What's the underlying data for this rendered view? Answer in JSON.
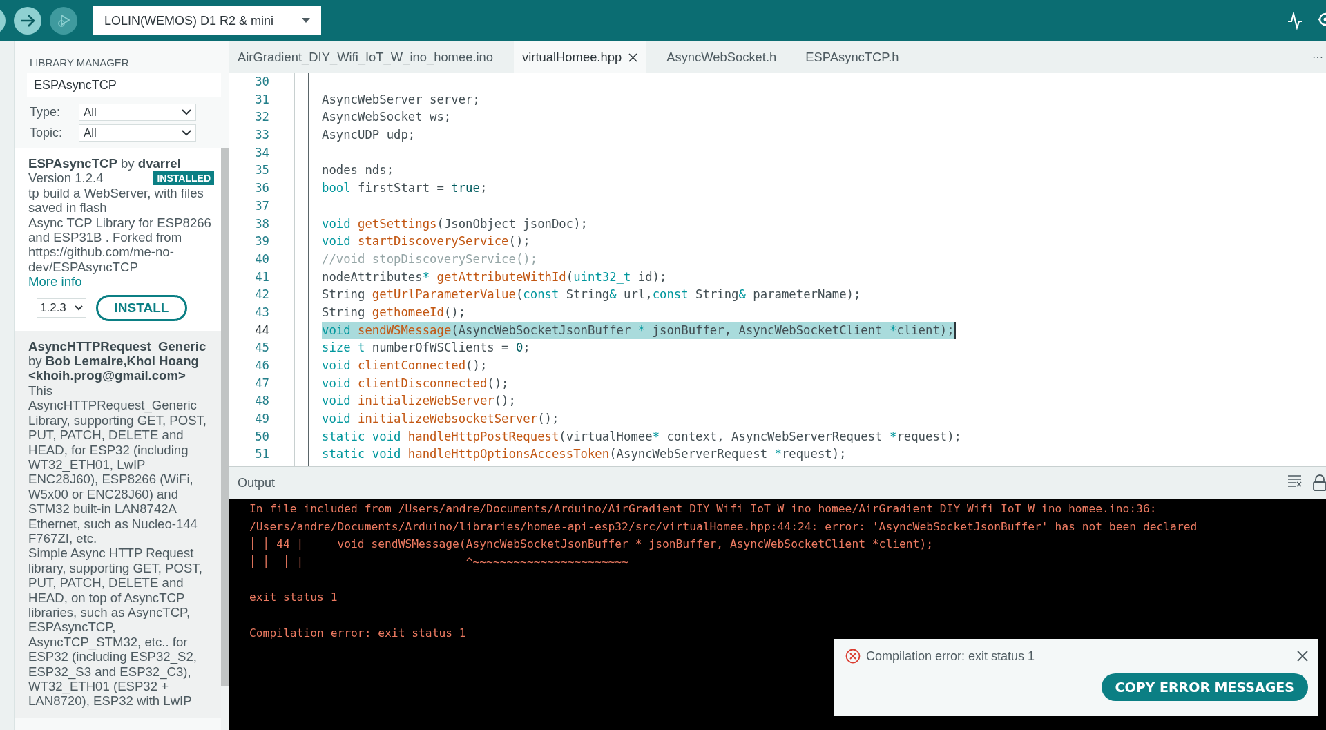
{
  "toolbar": {
    "board": "LOLIN(WEMOS) D1 R2 & mini"
  },
  "library_manager": {
    "title": "LIBRARY MANAGER",
    "search": {
      "value": "ESPAsyncTCP"
    },
    "filters": [
      {
        "label": "Type:",
        "value": "All"
      },
      {
        "label": "Topic:",
        "value": "All"
      }
    ],
    "libraries": [
      {
        "heading": "**ESPAsyncTCP** by **dvarrel**",
        "version": "Version 1.2.4",
        "badge": "INSTALLED",
        "description": [
          "tp build a WebServer, with files saved in flash",
          "Async TCP Library for ESP8266 and ESP31B . Forked from https://github.com/me-no-dev/ESPAsyncTCP"
        ],
        "link": "More info",
        "version_select": "1.2.3",
        "button": "INSTALL"
      },
      {
        "heading": "**AsyncHTTPRequest_Generic** by **Bob Lemaire,Khoi Hoang <khoih.prog@gmail.com>**",
        "description": [
          "This AsyncHTTPRequest_Generic Library, supporting GET, POST, PUT, PATCH, DELETE and HEAD, for ESP32 (including WT32_ETH01, LwIP ENC28J60), ESP8266 (WiFi, W5x00 or ENC28J60) and STM32 built-in LAN8742A Ethernet, such as Nucleo-144 F767ZI, etc.",
          "Simple Async HTTP Request library, supporting GET, POST, PUT, PATCH, DELETE and HEAD, on top of AsyncTCP libraries, such as AsyncTCP, ESPAsyncTCP, AsyncTCP_STM32, etc.. for ESP32 (including ESP32_S2, ESP32_S3 and ESP32_C3), WT32_ETH01 (ESP32 + LAN8720), ESP32 with LwIP"
        ]
      }
    ]
  },
  "editor": {
    "tabs": [
      {
        "label": "AirGradient_DIY_Wifi_IoT_W_ino_homee.ino",
        "selected": false
      },
      {
        "label": "virtualHomee.hpp",
        "selected": true
      },
      {
        "label": "AsyncWebSocket.h",
        "selected": false
      },
      {
        "label": "ESPAsyncTCP.h",
        "selected": false
      }
    ],
    "more": "···",
    "lines": [
      {
        "number": "30",
        "selected": false
      },
      {
        "number": "31",
        "selected": false,
        "tokens": [
          {
            "kind": "plain",
            "text": "AsyncWebServer server;"
          }
        ]
      },
      {
        "number": "32",
        "selected": false,
        "tokens": [
          {
            "kind": "plain",
            "text": "AsyncWebSocket ws;"
          }
        ]
      },
      {
        "number": "33",
        "selected": false,
        "tokens": [
          {
            "kind": "plain",
            "text": "AsyncUDP udp;"
          }
        ]
      },
      {
        "number": "34",
        "selected": false
      },
      {
        "number": "35",
        "selected": false,
        "tokens": [
          {
            "kind": "plain",
            "text": "nodes nds;"
          }
        ]
      },
      {
        "number": "36",
        "selected": false,
        "tokens": [
          {
            "kind": "keyword",
            "text": "bool"
          },
          {
            "kind": "plain",
            "text": " firstStart = "
          },
          {
            "kind": "literal",
            "text": "true"
          },
          {
            "kind": "plain",
            "text": ";"
          }
        ]
      },
      {
        "number": "37",
        "selected": false
      },
      {
        "number": "38",
        "selected": false,
        "tokens": [
          {
            "kind": "keyword",
            "text": "void"
          },
          {
            "kind": "function",
            "text": " getSettings"
          },
          {
            "kind": "plain",
            "text": "(JsonObject jsonDoc);"
          }
        ]
      },
      {
        "number": "39",
        "selected": false,
        "tokens": [
          {
            "kind": "keyword",
            "text": "void"
          },
          {
            "kind": "function",
            "text": " startDiscoveryService"
          },
          {
            "kind": "plain",
            "text": "();"
          }
        ]
      },
      {
        "number": "40",
        "selected": false,
        "tokens": [
          {
            "kind": "comment",
            "text": "//void stopDiscoveryService();"
          }
        ]
      },
      {
        "number": "41",
        "selected": false,
        "tokens": [
          {
            "kind": "plain",
            "text": "nodeAttributes"
          },
          {
            "kind": "keyword",
            "text": "*"
          },
          {
            "kind": "function",
            "text": " getAttributeWithId"
          },
          {
            "kind": "plain",
            "text": "("
          },
          {
            "kind": "keyword",
            "text": "uint32_t"
          },
          {
            "kind": "plain",
            "text": " id);"
          }
        ]
      },
      {
        "number": "42",
        "selected": false,
        "tokens": [
          {
            "kind": "plain",
            "text": "String "
          },
          {
            "kind": "function",
            "text": "getUrlParameterValue"
          },
          {
            "kind": "plain",
            "text": "("
          },
          {
            "kind": "keyword",
            "text": "const"
          },
          {
            "kind": "plain",
            "text": " String"
          },
          {
            "kind": "keyword",
            "text": "&"
          },
          {
            "kind": "plain",
            "text": " url,"
          },
          {
            "kind": "keyword",
            "text": "const"
          },
          {
            "kind": "plain",
            "text": " String"
          },
          {
            "kind": "keyword",
            "text": "&"
          },
          {
            "kind": "plain",
            "text": " parameterName);"
          }
        ]
      },
      {
        "number": "43",
        "selected": false,
        "tokens": [
          {
            "kind": "plain",
            "text": "String "
          },
          {
            "kind": "function",
            "text": "gethomeeId"
          },
          {
            "kind": "plain",
            "text": "();"
          }
        ]
      },
      {
        "number": "44",
        "selected": true,
        "tokens": [
          {
            "kind": "keyword",
            "text": "void"
          },
          {
            "kind": "function",
            "text": " sendWSMessage"
          },
          {
            "kind": "plain",
            "text": "(AsyncWebSocketJsonBuffer "
          },
          {
            "kind": "keyword",
            "text": "*"
          },
          {
            "kind": "plain",
            "text": " jsonBuffer, AsyncWebSocketClient "
          },
          {
            "kind": "keyword",
            "text": "*"
          },
          {
            "kind": "plain",
            "text": "client);"
          }
        ]
      },
      {
        "number": "45",
        "selected": false,
        "tokens": [
          {
            "kind": "keyword",
            "text": "size_t"
          },
          {
            "kind": "plain",
            "text": " numberOfWSClients = "
          },
          {
            "kind": "literal",
            "text": "0"
          },
          {
            "kind": "plain",
            "text": ";"
          }
        ]
      },
      {
        "number": "46",
        "selected": false,
        "tokens": [
          {
            "kind": "keyword",
            "text": "void"
          },
          {
            "kind": "function",
            "text": " clientConnected"
          },
          {
            "kind": "plain",
            "text": "();"
          }
        ]
      },
      {
        "number": "47",
        "selected": false,
        "tokens": [
          {
            "kind": "keyword",
            "text": "void"
          },
          {
            "kind": "function",
            "text": " clientDisconnected"
          },
          {
            "kind": "plain",
            "text": "();"
          }
        ]
      },
      {
        "number": "48",
        "selected": false,
        "tokens": [
          {
            "kind": "keyword",
            "text": "void"
          },
          {
            "kind": "function",
            "text": " initializeWebServer"
          },
          {
            "kind": "plain",
            "text": "();"
          }
        ]
      },
      {
        "number": "49",
        "selected": false,
        "tokens": [
          {
            "kind": "keyword",
            "text": "void"
          },
          {
            "kind": "function",
            "text": " initializeWebsocketServer"
          },
          {
            "kind": "plain",
            "text": "();"
          }
        ]
      },
      {
        "number": "50",
        "selected": false,
        "tokens": [
          {
            "kind": "keyword",
            "text": "static void"
          },
          {
            "kind": "function",
            "text": " handleHttpPostRequest"
          },
          {
            "kind": "plain",
            "text": "(virtualHomee"
          },
          {
            "kind": "keyword",
            "text": "*"
          },
          {
            "kind": "plain",
            "text": " context, AsyncWebServerRequest "
          },
          {
            "kind": "keyword",
            "text": "*"
          },
          {
            "kind": "plain",
            "text": "request);"
          }
        ]
      },
      {
        "number": "51",
        "selected": false,
        "tokens": [
          {
            "kind": "keyword",
            "text": "static void"
          },
          {
            "kind": "function",
            "text": " handleHttpOptionsAccessToken"
          },
          {
            "kind": "plain",
            "text": "(AsyncWebServerRequest "
          },
          {
            "kind": "keyword",
            "text": "*"
          },
          {
            "kind": "plain",
            "text": "request);"
          }
        ]
      }
    ]
  },
  "output": {
    "title": "Output",
    "blocks": [
      [
        "In file included from /Users/andre/Documents/Arduino/AirGradient_DIY_Wifi_IoT_W_ino_homee/AirGradient_DIY_Wifi_IoT_W_ino_homee.ino:36:",
        "/Users/andre/Documents/Arduino/libraries/homee-api-esp32/src/virtualHomee.hpp:44:24: error: 'AsyncWebSocketJsonBuffer' has not been declared",
        "│ │ 44 |     void sendWSMessage(AsyncWebSocketJsonBuffer * jsonBuffer, AsyncWebSocketClient *client);",
        "│ │  │ |                        ^~~~~~~~~~~~~~~~~~~~~~~~"
      ],
      [
        "exit status 1"
      ],
      [
        "Compilation error: exit status 1"
      ]
    ]
  },
  "notification": {
    "message": "Compilation error: exit status 1",
    "button": "COPY ERROR MESSAGES"
  }
}
